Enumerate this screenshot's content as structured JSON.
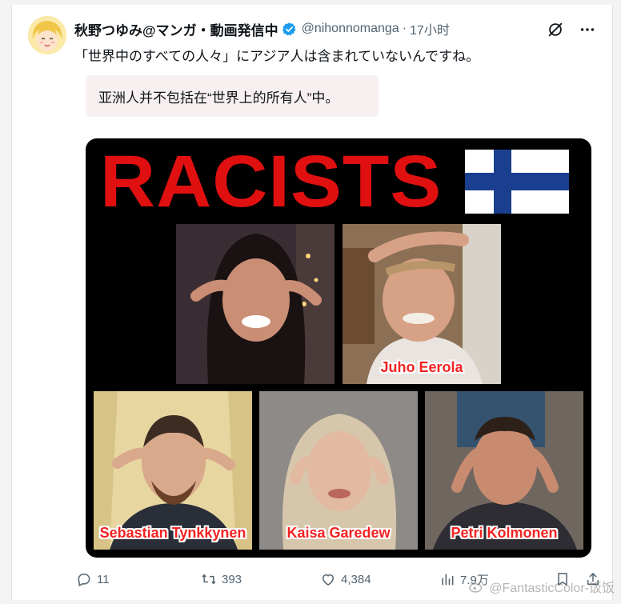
{
  "author": {
    "display_name": "秋野つゆみ@マンガ・動画発信中",
    "handle": "@nihonnomanga",
    "separator": "·",
    "time": "17小时"
  },
  "tweet": {
    "text": "「世界中のすべての人々」にアジア人は含まれていないんですね。",
    "translation": "亚洲人并不包括在“世界上的所有人”中。"
  },
  "media": {
    "headline": "RACISTS",
    "captions": [
      "Juho Eerola",
      "Sebastian Tynkkynen",
      "Kaisa Garedew",
      "Petri Kolmonen"
    ]
  },
  "stats": {
    "replies": "11",
    "reposts": "393",
    "likes": "4,384",
    "views": "7.9万"
  },
  "watermark": "@FantasticColor-饭饭",
  "colors": {
    "headline_red": "#e01010",
    "verified_blue": "#1d9bf0",
    "flag_blue": "#1b3f8f"
  },
  "icons": [
    "grok-icon",
    "more-icon",
    "reply-icon",
    "repost-icon",
    "like-icon",
    "views-icon",
    "bookmark-icon",
    "share-icon"
  ]
}
